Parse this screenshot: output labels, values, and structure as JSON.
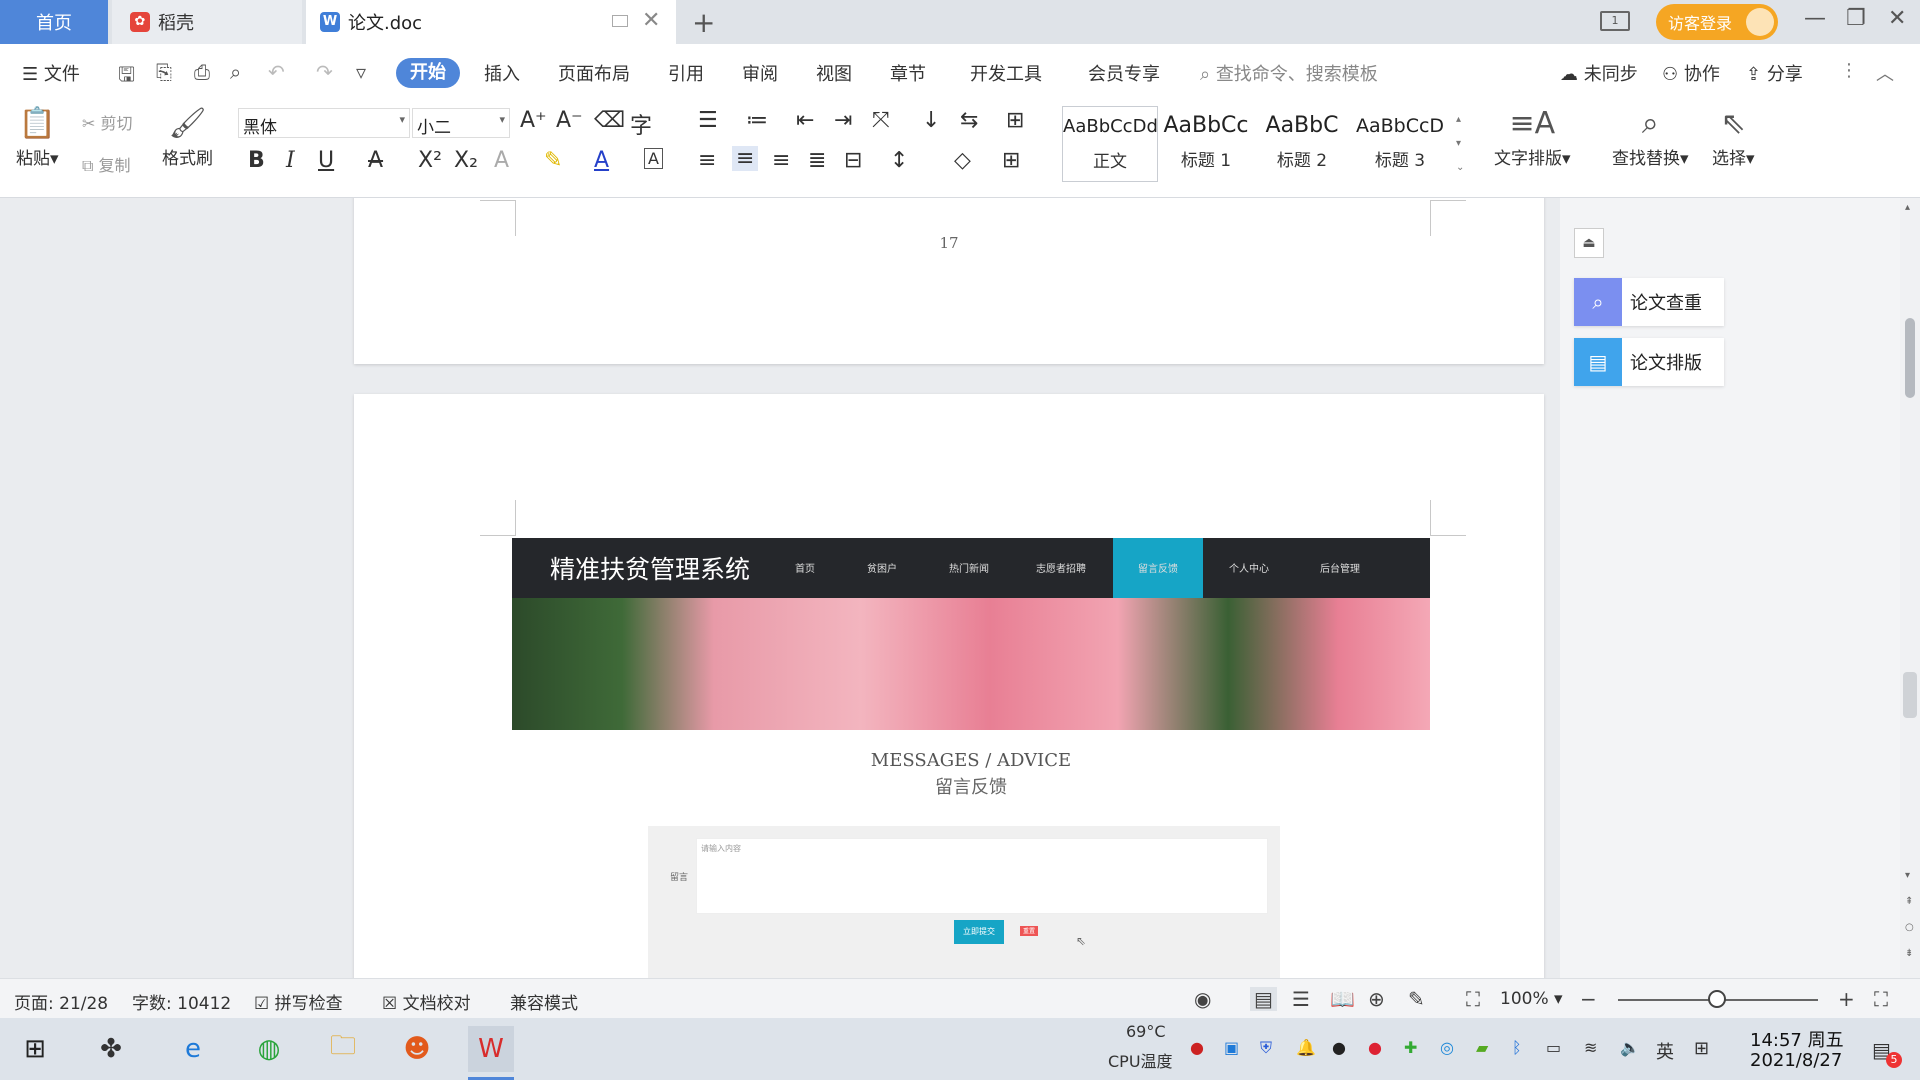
{
  "titlebar": {
    "tabs": [
      {
        "label": "首页"
      },
      {
        "label": "稻壳"
      },
      {
        "label": "论文.doc"
      }
    ],
    "layout_indicator": "1",
    "visitor_login": "访客登录"
  },
  "menu": {
    "file": "文件",
    "items": [
      "开始",
      "插入",
      "页面布局",
      "引用",
      "审阅",
      "视图",
      "章节",
      "开发工具",
      "会员专享"
    ],
    "search_placeholder": "查找命令、搜索模板",
    "unsynced": "未同步",
    "collaborate": "协作",
    "share": "分享"
  },
  "ribbon": {
    "paste": "粘贴",
    "cut": "剪切",
    "copy": "复制",
    "format_painter": "格式刷",
    "font_name": "黑体",
    "font_size": "小二",
    "styles": [
      {
        "sample": "AaBbCcDd",
        "label": "正文"
      },
      {
        "sample": "AaBbCc",
        "label": "标题 1"
      },
      {
        "sample": "AaBbC",
        "label": "标题 2"
      },
      {
        "sample": "AaBbCcD",
        "label": "标题 3"
      }
    ],
    "text_layout": "文字排版",
    "find_replace": "查找替换",
    "select": "选择"
  },
  "document": {
    "page_number": "17",
    "embedded_site": {
      "title": "精准扶贫管理系统",
      "nav": [
        "首页",
        "贫困户",
        "热门新闻",
        "志愿者招聘",
        "留言反馈",
        "个人中心",
        "后台管理"
      ],
      "heading": "MESSAGES / ADVICE",
      "subheading": "留言反馈",
      "form_label": "留言",
      "textarea_placeholder": "请输入内容",
      "submit": "立即提交",
      "reset": "重置"
    }
  },
  "side_panel": {
    "check": "论文查重",
    "format": "论文排版"
  },
  "status": {
    "page": "页面: 21/28",
    "words": "字数: 10412",
    "spell": "拼写检查",
    "proof": "文档校对",
    "compat": "兼容模式",
    "zoom": "100%"
  },
  "taskbar": {
    "cpu_temp": "69°C",
    "cpu_label": "CPU温度",
    "ime": "英",
    "time": "14:57 周五",
    "date": "2021/8/27",
    "notif_count": "5"
  }
}
